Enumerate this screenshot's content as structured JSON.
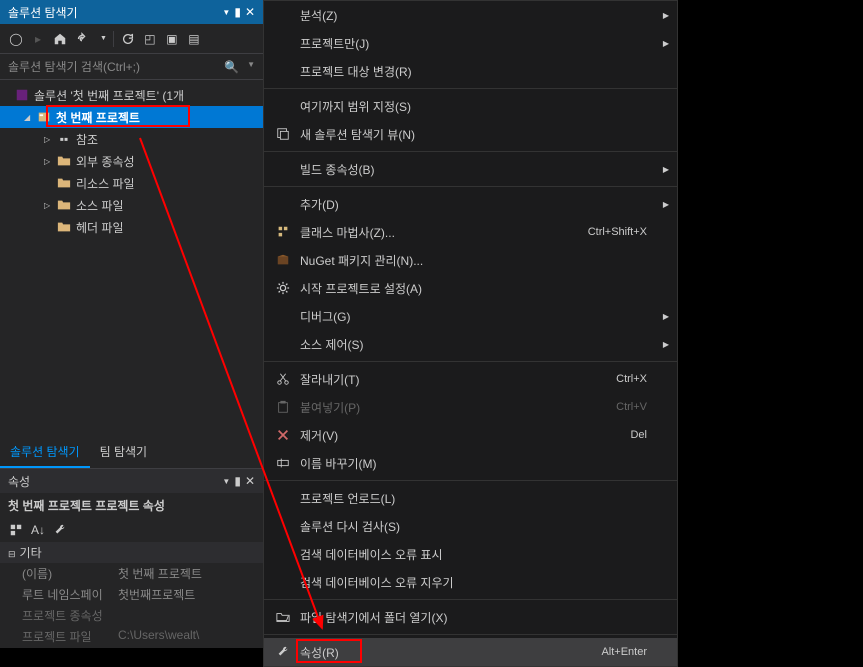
{
  "panel": {
    "title": "솔루션 탐색기",
    "search_placeholder": "솔루션 탐색기 검색(Ctrl+;)"
  },
  "tree": {
    "solution": "솔루션 '첫 번째 프로젝트' (1개",
    "project": "첫 번째 프로젝트",
    "refs": "참조",
    "external": "외부 종속성",
    "resource": "리소스 파일",
    "source": "소스 파일",
    "header": "헤더 파일"
  },
  "tabs": {
    "solution": "솔루션 탐색기",
    "team": "팀 탐색기"
  },
  "props": {
    "title": "속성",
    "subtitle": "첫 번째 프로젝트 프로젝트 속성",
    "category": "기타",
    "rows": [
      {
        "key": "(이름)",
        "val": "첫 번째 프로젝트"
      },
      {
        "key": "루트 네임스페이",
        "val": "첫번째프로젝트"
      },
      {
        "key": "프로젝트 종속성",
        "val": ""
      },
      {
        "key": "프로젝트 파일",
        "val": "C:\\Users\\wealt\\"
      }
    ]
  },
  "menu": {
    "items": [
      {
        "label": "분석(Z)",
        "sub": true
      },
      {
        "label": "프로젝트만(J)",
        "sub": true
      },
      {
        "label": "프로젝트 대상 변경(R)"
      },
      {
        "sep": true
      },
      {
        "label": "여기까지 범위 지정(S)"
      },
      {
        "label": "새 솔루션 탐색기 뷰(N)",
        "icon": "new-view"
      },
      {
        "sep": true
      },
      {
        "label": "빌드 종속성(B)",
        "sub": true
      },
      {
        "sep": true
      },
      {
        "label": "추가(D)",
        "sub": true
      },
      {
        "label": "클래스 마법사(Z)...",
        "icon": "class-wizard",
        "shortcut": "Ctrl+Shift+X"
      },
      {
        "label": "NuGet 패키지 관리(N)...",
        "icon": "nuget"
      },
      {
        "label": "시작 프로젝트로 설정(A)",
        "icon": "gear"
      },
      {
        "label": "디버그(G)",
        "sub": true
      },
      {
        "label": "소스 제어(S)",
        "sub": true
      },
      {
        "sep": true
      },
      {
        "label": "잘라내기(T)",
        "icon": "cut",
        "shortcut": "Ctrl+X"
      },
      {
        "label": "붙여넣기(P)",
        "icon": "paste",
        "shortcut": "Ctrl+V",
        "disabled": true
      },
      {
        "label": "제거(V)",
        "icon": "delete",
        "shortcut": "Del"
      },
      {
        "label": "이름 바꾸기(M)",
        "icon": "rename"
      },
      {
        "sep": true
      },
      {
        "label": "프로젝트 언로드(L)"
      },
      {
        "label": "솔루션 다시 검사(S)"
      },
      {
        "label": "검색 데이터베이스 오류 표시"
      },
      {
        "label": "검색 데이터베이스 오류 지우기"
      },
      {
        "sep": true
      },
      {
        "label": "파일 탐색기에서 폴더 열기(X)",
        "icon": "open-folder"
      },
      {
        "sep": true
      },
      {
        "label": "속성(R)",
        "icon": "wrench",
        "shortcut": "Alt+Enter",
        "hover": true,
        "highlight": true
      }
    ]
  }
}
